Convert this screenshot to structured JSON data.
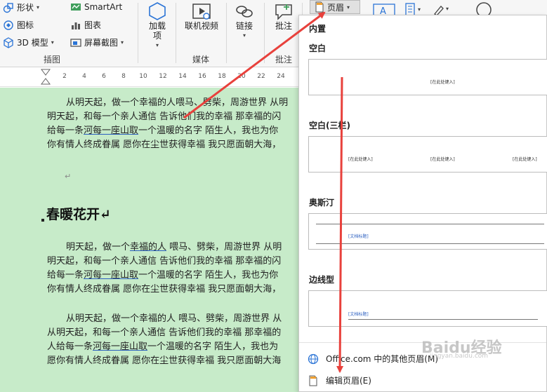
{
  "ribbon": {
    "shapes_label": "形状",
    "smartart_label": "SmartArt",
    "icons_label": "图标",
    "chart_label": "图表",
    "model3d_label": "3D 模型",
    "screenshot_label": "屏幕截图",
    "addins_label": "加载项",
    "online_video_label": "联机视频",
    "link_label": "链接",
    "comment_label": "批注",
    "header_label": "页眉",
    "group_illustrations": "插图",
    "group_media": "媒体",
    "group_comments": "批注"
  },
  "ruler": {
    "ticks": [
      "2",
      "4",
      "6",
      "8",
      "10",
      "12",
      "14",
      "16",
      "18",
      "20",
      "22",
      "24"
    ]
  },
  "document": {
    "para1": [
      "从明天起，做一个幸福的人喂马、劈柴，周游世界  从明",
      "明天起，和每一个亲人通信  告诉他们我的幸福  那幸福的闪",
      "给每一条河每一座山取一个温暖的名字  陌生人，我也为你",
      "你有情人终成眷属  愿你在尘世获得幸福  我只愿面朝大海，"
    ],
    "para1_underlined": "河每一座山取",
    "return_mark": "↵",
    "heading": "春暖花开↵",
    "para2": [
      "明天起，做一个幸福的人  喂马、劈柴，周游世界  从明",
      "明天起，和每一个亲人通信  告诉他们我的幸福  那幸福的闪",
      "给每一条河每一座山取一个温暖的名字  陌生人，我也为你",
      "你有情人终成眷属  愿你在尘世获得幸福  我只愿面朝大海，"
    ],
    "para3": [
      "从明天起，做一个幸福的人  喂马、劈柴，周游世界  从",
      "从明天起，和每一个亲人通信  告诉他们我的幸福  那幸福的",
      "人给每一条河每一座山取一个温暖的名字  陌生人，我也为",
      "愿你有情人终成眷属  愿你在尘世获得幸福  我只愿面朝大海"
    ]
  },
  "dropdown": {
    "section_builtin": "内置",
    "item_blank": "空白",
    "item_blank3": "空白(三栏)",
    "item_austin": "奥斯汀",
    "item_sideline": "边线型",
    "placeholder_type_here": "[在此处键入]",
    "placeholder_doc_title": "[文档标题]",
    "more_headers": "Office.com 中的其他页眉(M)",
    "edit_header": "编辑页眉(E)"
  },
  "watermark": {
    "main": "Baidu经验",
    "sub": "jingyan.baidu.com"
  },
  "colors": {
    "arrow": "#e8413c",
    "doc_bg": "#c7ebc9",
    "accent_blue": "#2b74d6"
  }
}
